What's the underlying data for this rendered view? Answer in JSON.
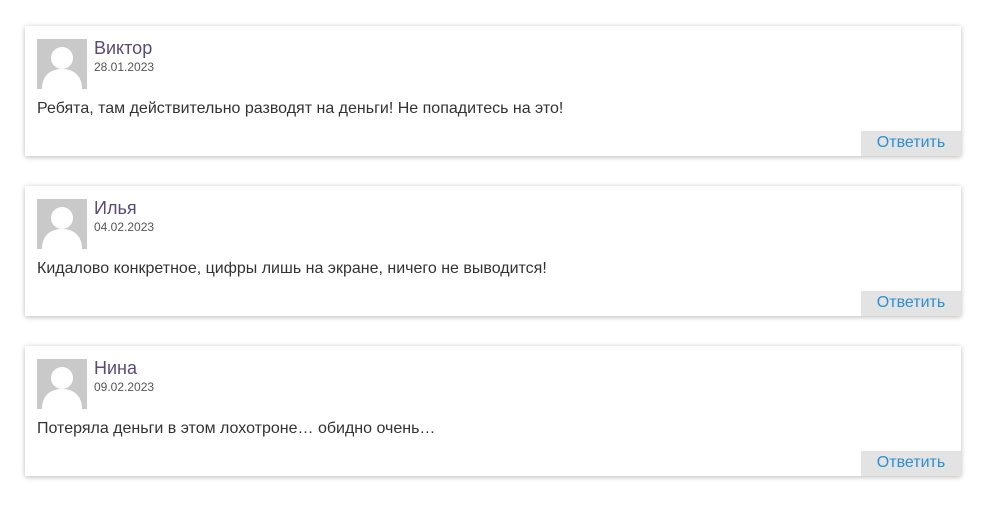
{
  "comments": [
    {
      "author": "Виктор",
      "date": "28.01.2023",
      "text": "Ребята, там действительно разводят на деньги! Не попадитесь на это!",
      "reply_label": "Ответить",
      "avatar_icon": "default-avatar-icon"
    },
    {
      "author": "Илья",
      "date": "04.02.2023",
      "text": "Кидалово конкретное, цифры лишь на экране, ничего не выводится!",
      "reply_label": "Ответить",
      "avatar_icon": "default-avatar-icon"
    },
    {
      "author": "Нина",
      "date": "09.02.2023",
      "text": "Потеряла деньги в этом лохотроне… обидно очень…",
      "reply_label": "Ответить",
      "avatar_icon": "default-avatar-icon"
    }
  ],
  "colors": {
    "author_name": "#5a4a78",
    "reply_link": "#2a8fd0",
    "reply_background": "#e3e3e3",
    "avatar_background": "#c9c9c9"
  }
}
